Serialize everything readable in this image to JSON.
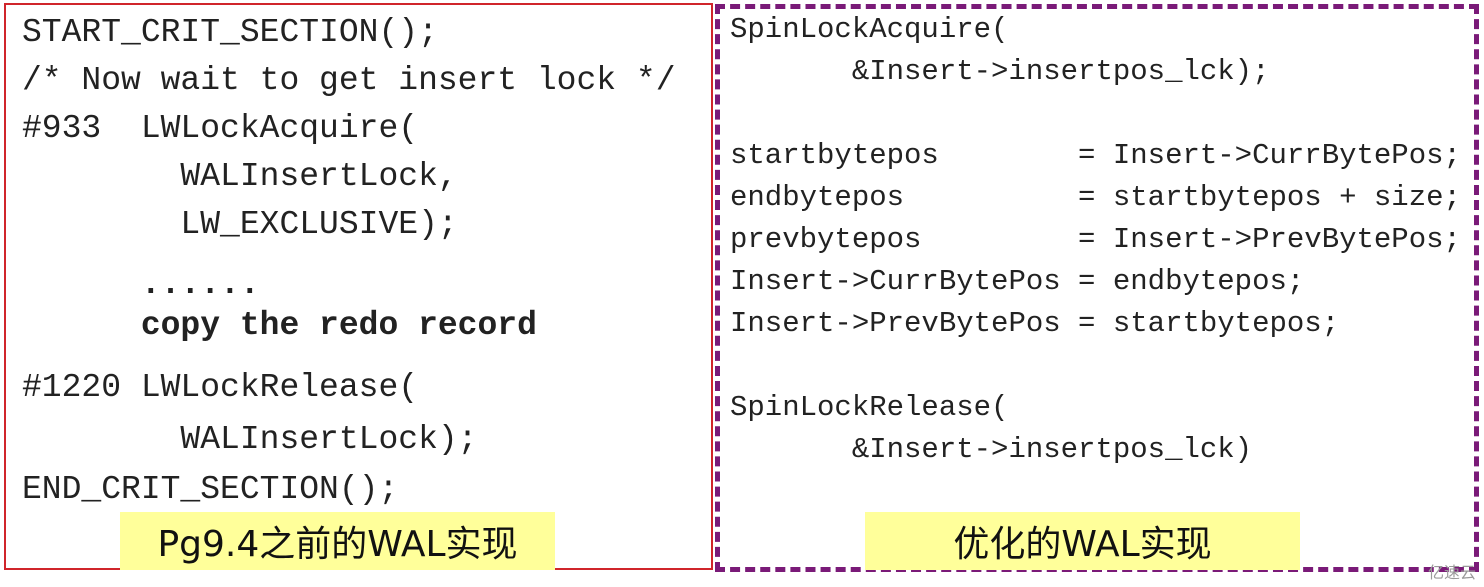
{
  "left_panel": {
    "lines": [
      "START_CRIT_SECTION();",
      "/* Now wait to get insert lock */",
      "#933  LWLockAcquire(",
      "        WALInsertLock,",
      "        LW_EXCLUSIVE);",
      "      ......",
      "      copy the redo record",
      "#1220 LWLockRelease(",
      "        WALInsertLock);",
      "END_CRIT_SECTION();"
    ],
    "caption": "Pg9.4之前的WAL实现"
  },
  "right_panel": {
    "lines": [
      "SpinLockAcquire(",
      "       &Insert->insertpos_lck);",
      "startbytepos        = Insert->CurrBytePos;",
      "endbytepos          = startbytepos + size;",
      "prevbytepos         = Insert->PrevBytePos;",
      "Insert->CurrBytePos = endbytepos;",
      "Insert->PrevBytePos = startbytepos;",
      "SpinLockRelease(",
      "       &Insert->insertpos_lck)"
    ],
    "caption": "优化的WAL实现"
  },
  "watermark": "亿速云",
  "colors": {
    "left_border": "#d0252b",
    "right_border": "#7a1a78",
    "caption_bg": "#ffff9a"
  }
}
